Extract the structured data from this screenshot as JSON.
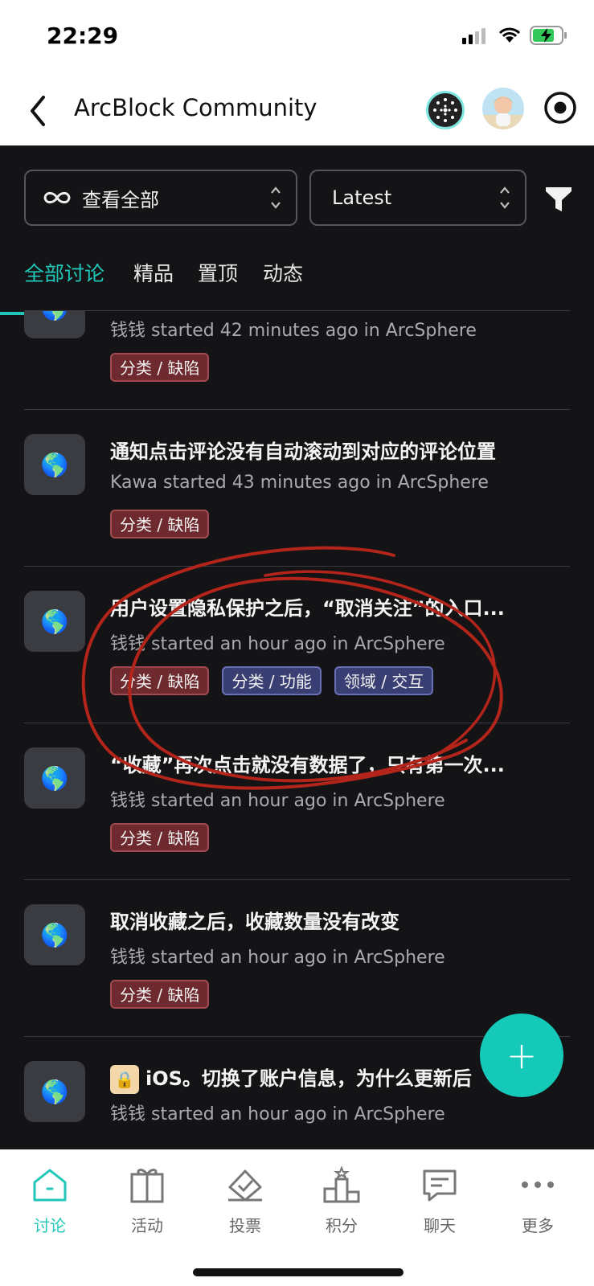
{
  "status_bar": {
    "time": "22:29"
  },
  "nav": {
    "title": "ArcBlock Community",
    "back_icon": "chevron-left-icon",
    "record_icon": "record-icon"
  },
  "filters": {
    "category": {
      "label": "查看全部",
      "icon": "infinity-icon"
    },
    "sort": {
      "label": "Latest"
    },
    "filter_icon": "funnel-icon"
  },
  "tabs": [
    {
      "label": "全部讨论",
      "active": true
    },
    {
      "label": "精品",
      "active": false
    },
    {
      "label": "置顶",
      "active": false
    },
    {
      "label": "动态",
      "active": false
    }
  ],
  "posts": [
    {
      "title": "",
      "author": "钱钱",
      "meta": "钱钱 started 42 minutes ago in ArcSphere",
      "tags": [
        {
          "label": "分类 / 缺陷",
          "color": "red"
        }
      ]
    },
    {
      "title": "通知点击评论没有自动滚动到对应的评论位置",
      "meta": "Kawa started 43 minutes ago in ArcSphere",
      "tags": [
        {
          "label": "分类 / 缺陷",
          "color": "red"
        }
      ]
    },
    {
      "title": "用户设置隐私保护之后，“取消关注”的入口...",
      "meta": "钱钱 started an hour ago in ArcSphere",
      "tags": [
        {
          "label": "分类 / 缺陷",
          "color": "red"
        },
        {
          "label": "分类 / 功能",
          "color": "blue"
        },
        {
          "label": "领域 / 交互",
          "color": "blue"
        }
      ]
    },
    {
      "title": "“收藏”再次点击就没有数据了，只有第一次...",
      "meta": "钱钱 started an hour ago in ArcSphere",
      "tags": [
        {
          "label": "分类 / 缺陷",
          "color": "red"
        }
      ]
    },
    {
      "title": "取消收藏之后，收藏数量没有改变",
      "meta": "钱钱 started an hour ago in ArcSphere",
      "tags": [
        {
          "label": "分类 / 缺陷",
          "color": "red"
        }
      ]
    },
    {
      "title": "iOS。切换了账户信息，为什么更新后",
      "meta": "钱钱 started an hour ago in ArcSphere",
      "tags": [],
      "locked": true
    }
  ],
  "fab": {
    "label": "+"
  },
  "tabbar": [
    {
      "label": "讨论",
      "icon": "home-icon",
      "active": true
    },
    {
      "label": "活动",
      "icon": "gift-icon",
      "active": false
    },
    {
      "label": "投票",
      "icon": "ballot-icon",
      "active": false
    },
    {
      "label": "积分",
      "icon": "podium-icon",
      "active": false
    },
    {
      "label": "聊天",
      "icon": "chat-icon",
      "active": false
    },
    {
      "label": "更多",
      "icon": "more-icon",
      "active": false
    }
  ],
  "colors": {
    "accent": "#20c7b8",
    "tag_red": "#6e2a2e",
    "tag_blue": "#3a3f73",
    "annotation": "#b3241a"
  }
}
